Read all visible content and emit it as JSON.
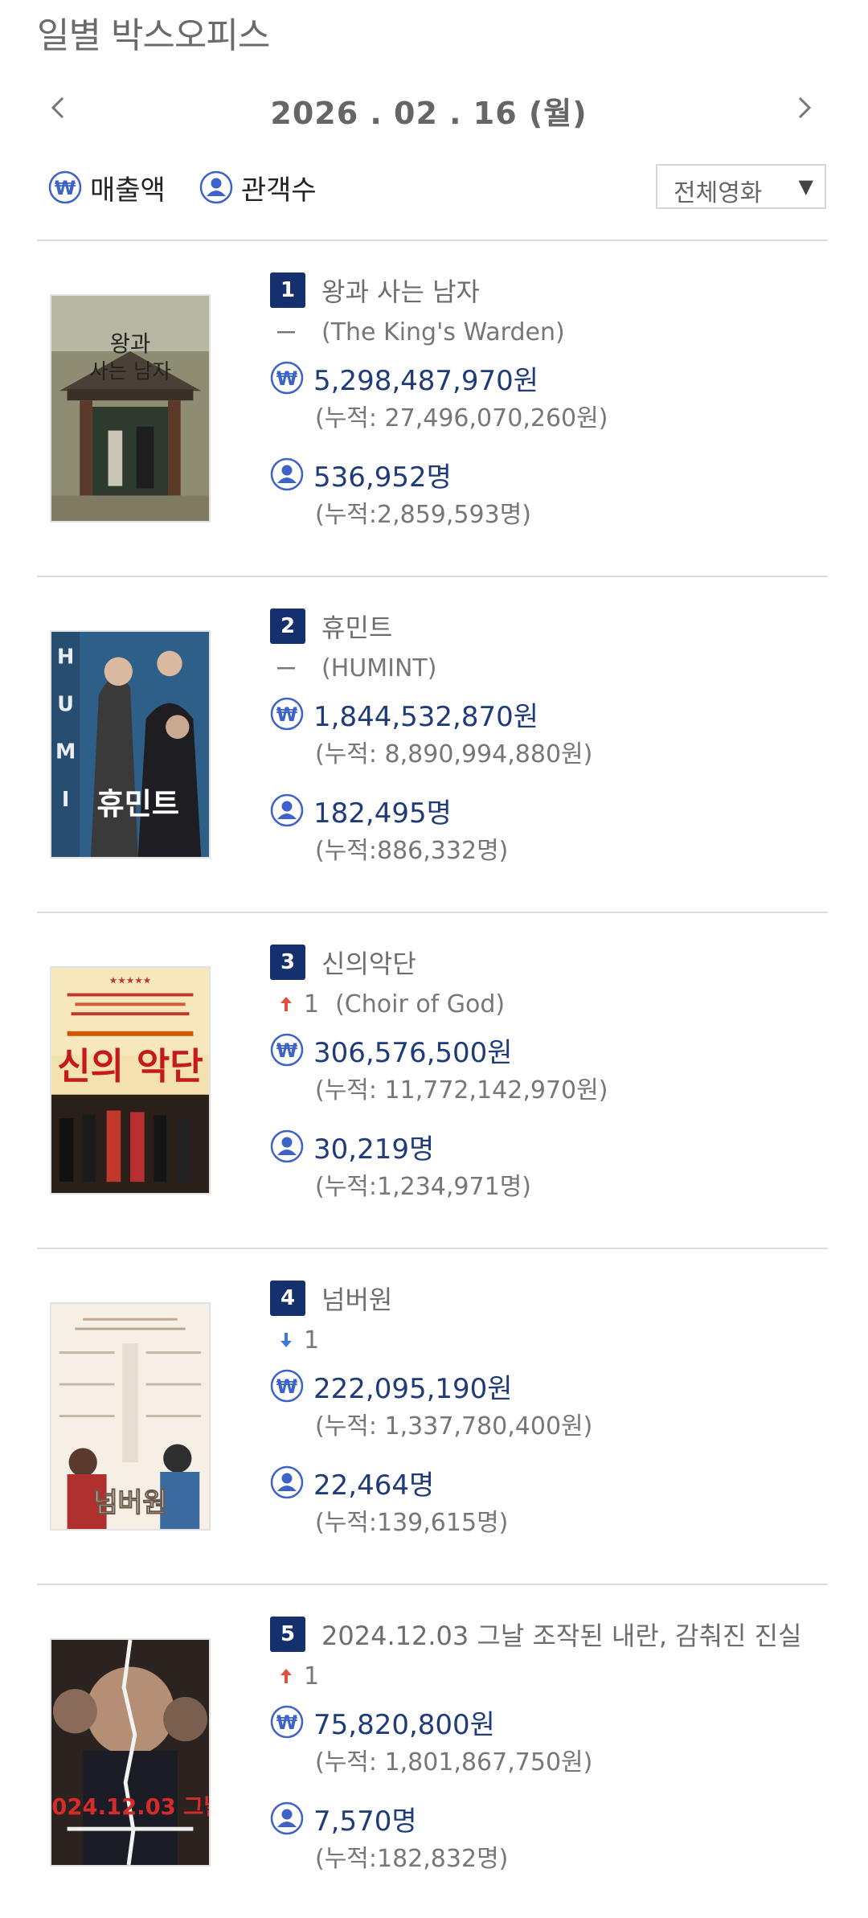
{
  "header": {
    "title": "일별 박스오피스",
    "date": "2026 . 02 . 16  (월)",
    "prev_icon": "chevron-left-icon",
    "next_icon": "chevron-right-icon"
  },
  "legend": {
    "revenue_label": "매출액",
    "audience_label": "관객수"
  },
  "filter": {
    "selected": "전체영화",
    "arrow": "▼"
  },
  "colors": {
    "accent": "#14306e",
    "value_text": "#1f3b7a",
    "icon_blue": "#3d63c9",
    "up": "#e0513a",
    "down": "#3d7ad6"
  },
  "movies": [
    {
      "rank": "1",
      "title": "왕과 사는 남자",
      "change_icon": "dash",
      "change": "",
      "en_title": "(The King's Warden)",
      "revenue": "5,298,487,970원",
      "revenue_cum": "(누적: 27,496,070,260원)",
      "audience": "536,952명",
      "audience_cum": "(누적:2,859,593명)"
    },
    {
      "rank": "2",
      "title": "휴민트",
      "change_icon": "dash",
      "change": "",
      "en_title": "(HUMINT)",
      "revenue": "1,844,532,870원",
      "revenue_cum": "(누적: 8,890,994,880원)",
      "audience": "182,495명",
      "audience_cum": "(누적:886,332명)"
    },
    {
      "rank": "3",
      "title": "신의악단",
      "change_icon": "up",
      "change": "1",
      "en_title": "(Choir of God)",
      "revenue": "306,576,500원",
      "revenue_cum": "(누적: 11,772,142,970원)",
      "audience": "30,219명",
      "audience_cum": "(누적:1,234,971명)"
    },
    {
      "rank": "4",
      "title": "넘버원",
      "change_icon": "down",
      "change": "1",
      "en_title": "",
      "revenue": "222,095,190원",
      "revenue_cum": "(누적: 1,337,780,400원)",
      "audience": "22,464명",
      "audience_cum": "(누적:139,615명)"
    },
    {
      "rank": "5",
      "title": "2024.12.03 그날 조작된 내란, 감춰진 진실",
      "change_icon": "up",
      "change": "1",
      "en_title": "",
      "revenue": "75,820,800원",
      "revenue_cum": "(누적: 1,801,867,750원)",
      "audience": "7,570명",
      "audience_cum": "(누적:182,832명)"
    }
  ]
}
